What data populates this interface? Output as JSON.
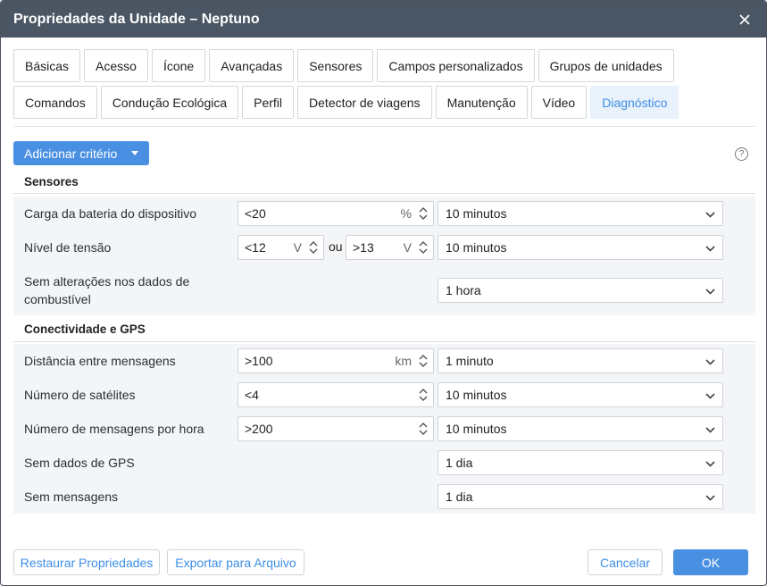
{
  "window": {
    "title": "Propriedades da Unidade – Neptuno"
  },
  "tabs": {
    "row1": [
      "Básicas",
      "Acesso",
      "Ícone",
      "Avançadas",
      "Sensores",
      "Campos personalizados",
      "Grupos de unidades"
    ],
    "row2": [
      "Comandos",
      "Condução Ecológica",
      "Perfil",
      "Detector de viagens",
      "Manutenção",
      "Vídeo",
      "Diagnóstico"
    ],
    "active": "Diagnóstico"
  },
  "toolbar": {
    "add_label": "Adicionar critério",
    "help_label": "?"
  },
  "sections": {
    "sensors": {
      "title": "Sensores",
      "battery": {
        "label": "Carga da bateria do dispositivo",
        "value": "<20",
        "unit": "%",
        "period": "10 minutos"
      },
      "voltage": {
        "label": "Nível de tensão",
        "low_value": "<12",
        "low_unit": "V",
        "or": "ou",
        "high_value": ">13",
        "high_unit": "V",
        "period": "10 minutos"
      },
      "fuel": {
        "label": "Sem alterações nos dados de combustível",
        "period": "1 hora"
      }
    },
    "gps": {
      "title": "Conectividade e GPS",
      "distance": {
        "label": "Distância entre mensagens",
        "value": ">100",
        "unit": "km",
        "period": "1 minuto"
      },
      "satellites": {
        "label": "Número de satélites",
        "value": "<4",
        "period": "10 minutos"
      },
      "messages_per_hour": {
        "label": "Número de mensagens por hora",
        "value": ">200",
        "period": "10 minutos"
      },
      "no_gps": {
        "label": "Sem dados de GPS",
        "period": "1 dia"
      },
      "no_messages": {
        "label": "Sem mensagens",
        "period": "1 dia"
      }
    }
  },
  "footer": {
    "restore": "Restaurar Propriedades",
    "export": "Exportar para Arquivo",
    "cancel": "Cancelar",
    "ok": "OK"
  },
  "colors": {
    "accent": "#4a90e2",
    "titlebar": "#4b5665"
  }
}
